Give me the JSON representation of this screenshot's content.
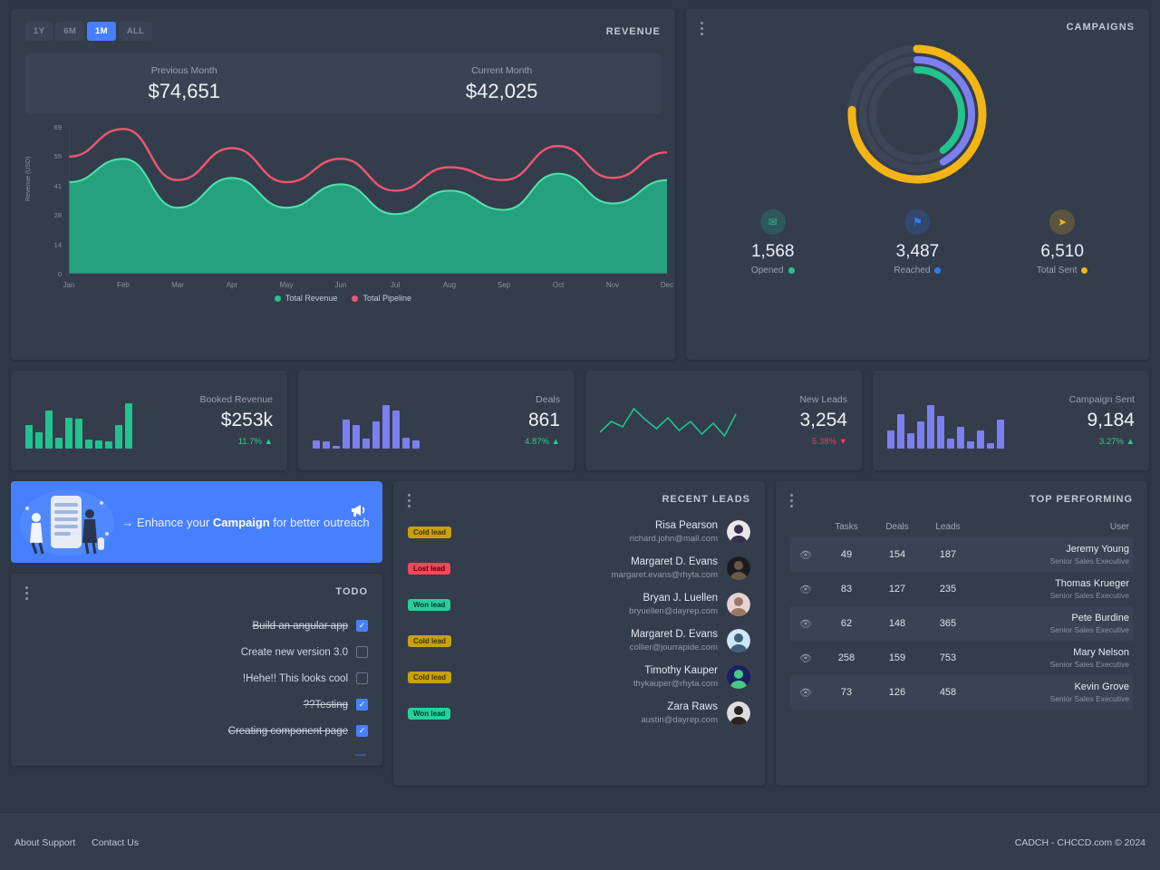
{
  "revenue_panel": {
    "title": "REVENUE",
    "ranges": [
      {
        "label": "1Y",
        "active": false
      },
      {
        "label": "6M",
        "active": false
      },
      {
        "label": "1M",
        "active": true
      },
      {
        "label": "ALL",
        "active": false
      }
    ],
    "previous_label": "Previous Month",
    "previous_value": "$74,651",
    "current_label": "Current Month",
    "current_value": "$42,025"
  },
  "chart_data": {
    "type": "area",
    "title": "Revenue",
    "xlabel": "",
    "ylabel": "Revenue (USD)",
    "categories": [
      "Jan",
      "Feb",
      "Mar",
      "Apr",
      "May",
      "Jun",
      "Jul",
      "Aug",
      "Sep",
      "Oct",
      "Nov",
      "Dec"
    ],
    "yticks": [
      "0",
      "14",
      "28",
      "41",
      "55",
      "69"
    ],
    "ylim": [
      0,
      69
    ],
    "grid": false,
    "legend_position": "bottom",
    "series": [
      {
        "name": "Total Revenue",
        "color": "#21c38f",
        "values": [
          43,
          54,
          31,
          45,
          31,
          42,
          28,
          39,
          30,
          47,
          33,
          44
        ]
      },
      {
        "name": "Total Pipeline",
        "color": "#f0566f",
        "values": [
          55,
          68,
          44,
          59,
          43,
          54,
          39,
          50,
          44,
          60,
          45,
          57
        ]
      }
    ]
  },
  "campaigns_panel": {
    "title": "CAMPAIGNS",
    "donut": {
      "rings": [
        {
          "name": "Total Sent",
          "color": "#f3b415",
          "percent": 76
        },
        {
          "name": "Reached",
          "color": "#7b7ff0",
          "percent": 42
        },
        {
          "name": "Opened",
          "color": "#21c38f",
          "percent": 40
        }
      ]
    },
    "stats": [
      {
        "icon": "mail-icon",
        "glyph": "✉",
        "value": "1,568",
        "label": "Opened",
        "color": "#21c38f"
      },
      {
        "icon": "flag-icon",
        "glyph": "⚑",
        "value": "3,487",
        "label": "Reached",
        "color": "#2f7ef5"
      },
      {
        "icon": "send-icon",
        "glyph": "➤",
        "value": "6,510",
        "label": "Total Sent",
        "color": "#f3b415"
      }
    ]
  },
  "kpis": [
    {
      "label": "Booked Revenue",
      "value": "$253k",
      "delta": "11.7%",
      "direction": "up",
      "arrow": "⬆",
      "spark_type": "bar",
      "color": "#21c38f",
      "bars": [
        26,
        18,
        42,
        12,
        34,
        33,
        10,
        9,
        8,
        26,
        50
      ]
    },
    {
      "label": "Deals",
      "value": "861",
      "delta": "4.87%",
      "direction": "up",
      "arrow": "⬆",
      "spark_type": "bar",
      "color": "#7b7ff0",
      "bars": [
        9,
        8,
        3,
        32,
        26,
        11,
        30,
        48,
        42,
        12,
        9
      ]
    },
    {
      "label": "New Leads",
      "value": "3,254",
      "delta": "5.38%",
      "direction": "down",
      "arrow": "⬇",
      "spark_type": "line",
      "color": "#21c38f",
      "line": [
        14,
        26,
        20,
        40,
        28,
        18,
        30,
        16,
        26,
        12,
        24,
        10,
        34
      ]
    },
    {
      "label": "Campaign Sent",
      "value": "9,184",
      "delta": "3.27%",
      "direction": "up",
      "arrow": "⬆",
      "spark_type": "bar",
      "color": "#7b7ff0",
      "bars": [
        20,
        38,
        17,
        30,
        48,
        36,
        11,
        24,
        8,
        20,
        6,
        32
      ]
    }
  ],
  "banner": {
    "arrow": "→",
    "text_before": "Enhance your ",
    "text_bold": "Campaign",
    "text_after": " for better outreach",
    "megaphone": "📣"
  },
  "todo_panel": {
    "title": "TODO",
    "items": [
      {
        "text": "Build an angular app",
        "done": true
      },
      {
        "text": "Create new version 3.0",
        "done": false
      },
      {
        "text": "!Hehe!! This looks cool",
        "done": false
      },
      {
        "text": "??Testing",
        "done": true
      },
      {
        "text": "Creating component page",
        "done": true
      }
    ],
    "more": "—"
  },
  "leads_panel": {
    "title": "RECENT LEADS",
    "items": [
      {
        "badge": "Cold lead",
        "badge_type": "cold",
        "name": "Risa Pearson",
        "email": "richard.john@mail.com",
        "avatar_bg": "#e9e6ea",
        "avatar_fg": "#36304a"
      },
      {
        "badge": "Lost lead",
        "badge_type": "lost",
        "name": "Margaret D. Evans",
        "email": "margaret.evans@rhyta.com",
        "avatar_bg": "#1d1c21",
        "avatar_fg": "#6b584a"
      },
      {
        "badge": "Won lead",
        "badge_type": "won",
        "name": "Bryan J. Luellen",
        "email": "bryuellen@dayrep.com",
        "avatar_bg": "#e6d2d2",
        "avatar_fg": "#9c7766"
      },
      {
        "badge": "Cold lead",
        "badge_type": "cold",
        "name": "Margaret D. Evans",
        "email": "collier@jourrapide.com",
        "avatar_bg": "#cfe8f7",
        "avatar_fg": "#3f5f7a"
      },
      {
        "badge": "Cold lead",
        "badge_type": "cold",
        "name": "Timothy Kauper",
        "email": "thykauper@rhyta.com",
        "avatar_bg": "#1d2060",
        "avatar_fg": "#49c987"
      },
      {
        "badge": "Won lead",
        "badge_type": "won",
        "name": "Zara Raws",
        "email": "austin@dayrep.com",
        "avatar_bg": "#dcdcdc",
        "avatar_fg": "#2a2320"
      }
    ]
  },
  "top_panel": {
    "title": "TOP PERFORMING",
    "columns": [
      "",
      "Tasks",
      "Deals",
      "Leads",
      "User"
    ],
    "rows": [
      {
        "tasks": "49",
        "deals": "154",
        "leads": "187",
        "name": "Jeremy Young",
        "role": "Senior Sales Executive"
      },
      {
        "tasks": "83",
        "deals": "127",
        "leads": "235",
        "name": "Thomas Krueger",
        "role": "Senior Sales Executive"
      },
      {
        "tasks": "62",
        "deals": "148",
        "leads": "365",
        "name": "Pete Burdine",
        "role": "Senior Sales Executive"
      },
      {
        "tasks": "258",
        "deals": "159",
        "leads": "753",
        "name": "Mary Nelson",
        "role": "Senior Sales Executive"
      },
      {
        "tasks": "73",
        "deals": "126",
        "leads": "458",
        "name": "Kevin Grove",
        "role": "Senior Sales Executive"
      }
    ]
  },
  "footer": {
    "links": [
      "About Support",
      "Contact Us"
    ],
    "copyright": "CADCH - CHCCD.com © 2024"
  }
}
